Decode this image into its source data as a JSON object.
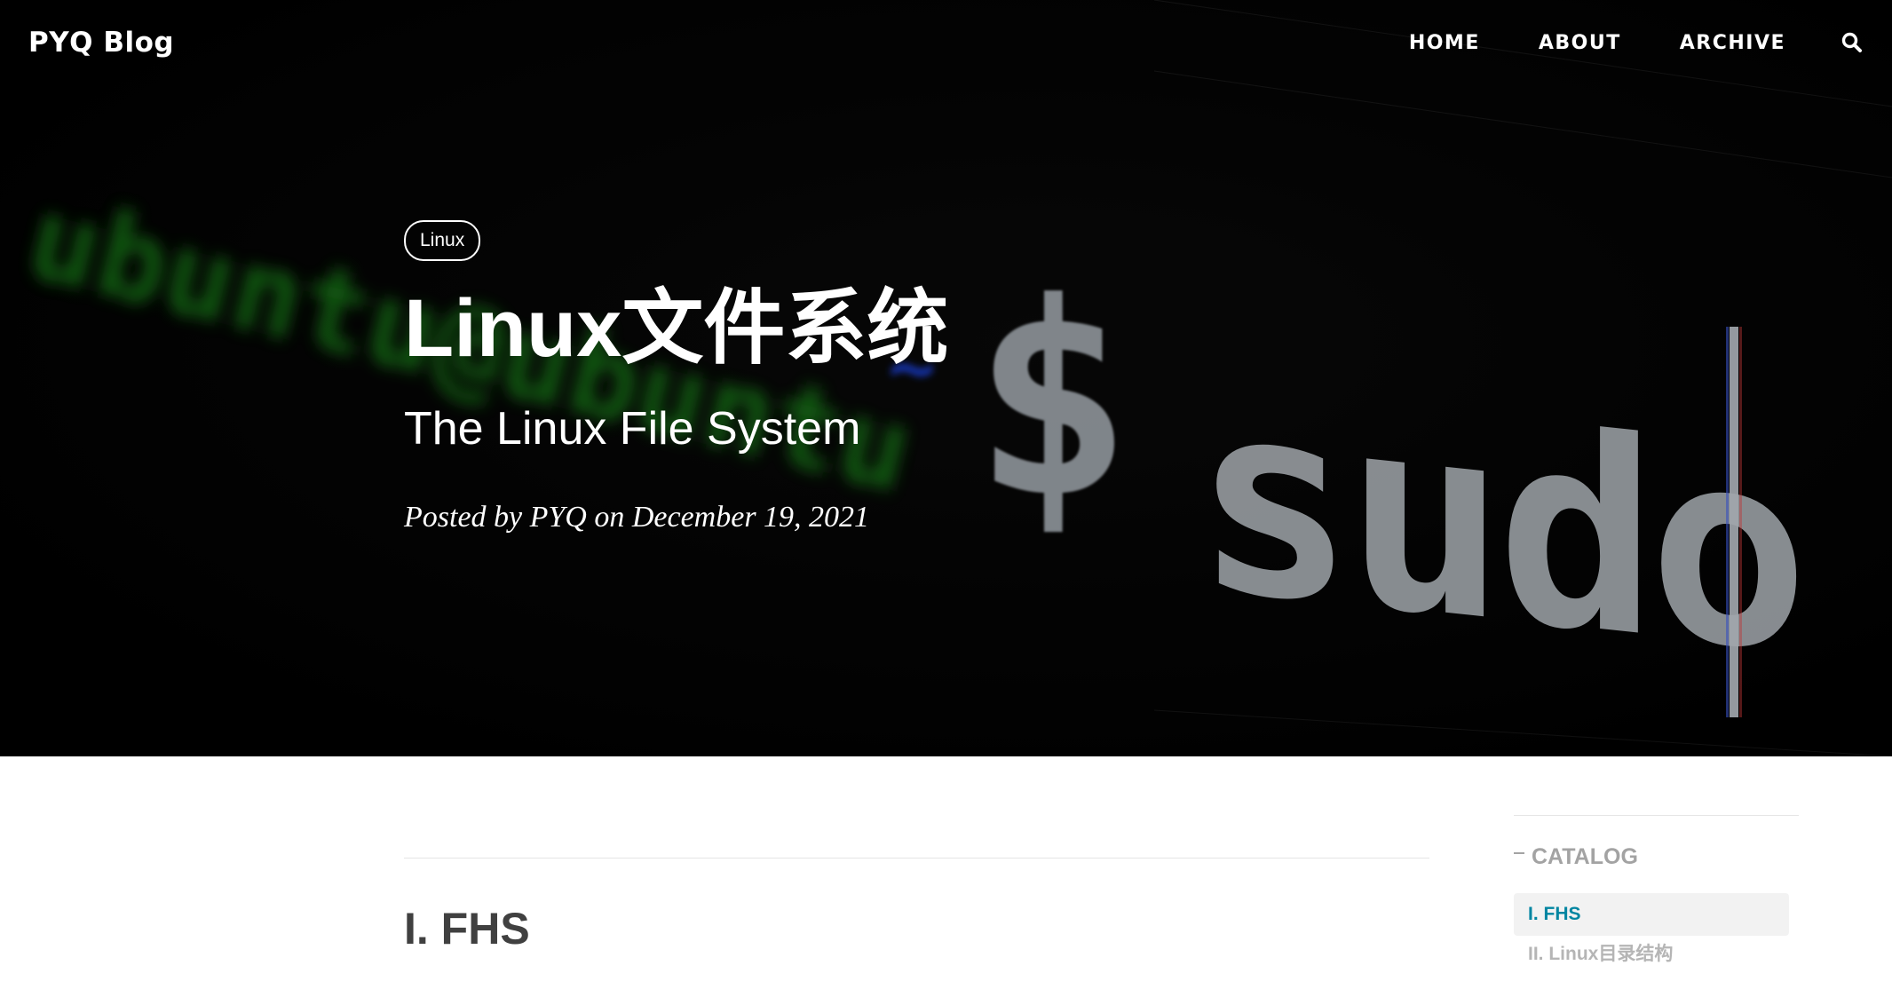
{
  "navbar": {
    "brand": "PYQ Blog",
    "links": [
      "HOME",
      "ABOUT",
      "ARCHIVE"
    ],
    "search_icon": "search-icon"
  },
  "hero": {
    "background_image": "terminal-closeup",
    "background_text": {
      "prompt": "ubuntu@ubuntu",
      "tilde": "~",
      "dollar": "$",
      "command": "sudo"
    },
    "tag": "Linux",
    "title": "Linux文件系统",
    "subtitle": "The Linux File System",
    "meta": "Posted by PYQ on December 19, 2021"
  },
  "article": {
    "heading": "I. FHS"
  },
  "catalog": {
    "title": "CATALOG",
    "items": [
      {
        "label": "I. FHS",
        "active": true
      },
      {
        "label": "II. Linux目录结构",
        "active": false
      }
    ]
  },
  "colors": {
    "link_active": "#0085a1",
    "heading": "#404040",
    "muted": "#a3a3a3"
  }
}
